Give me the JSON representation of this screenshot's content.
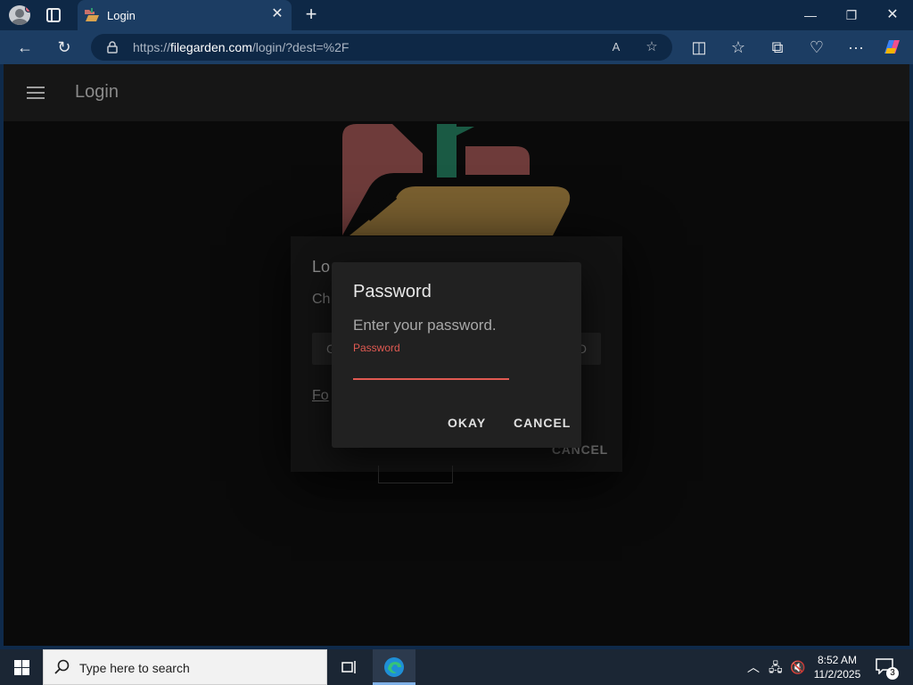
{
  "browser": {
    "tab": {
      "title": "Login"
    },
    "address": {
      "scheme_prefix": "https://",
      "domain": "filegarden.com",
      "path": "/login/?dest=%2F"
    }
  },
  "page": {
    "app_title": "Login",
    "login_card": {
      "title": "Lo",
      "subtitle": "Ch",
      "field_left": "G",
      "field_right": "D",
      "link": "Fo",
      "cancel": "CANCEL"
    },
    "password_dialog": {
      "title": "Password",
      "message": "Enter your password.",
      "field_label": "Password",
      "field_value": "",
      "okay": "OKAY",
      "cancel": "CANCEL"
    }
  },
  "taskbar": {
    "search_placeholder": "Type here to search",
    "time": "8:52 AM",
    "date": "11/2/2025",
    "notification_count": "3"
  },
  "colors": {
    "accent_error": "#e05a52",
    "browser_chrome": "#1c3d63",
    "logo_red": "#8a4a48",
    "logo_gold": "#9a7a3c",
    "logo_green": "#1f6b50"
  }
}
